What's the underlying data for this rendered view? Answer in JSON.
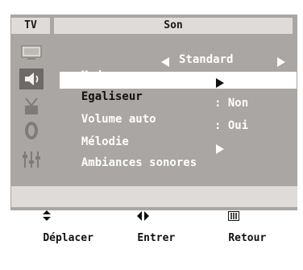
{
  "header": {
    "tv_label": "TV",
    "title": "Son"
  },
  "menu": {
    "items": [
      {
        "label": "Mode",
        "value": "Standard"
      },
      {
        "label": "Egaliseur"
      },
      {
        "label": "Volume auto",
        "value": ": Non"
      },
      {
        "label": "Mélodie",
        "value": ": Oui"
      },
      {
        "label": "Ambiances sonores"
      }
    ]
  },
  "footer": {
    "move_label": "Déplacer",
    "enter_label": "Entrer",
    "return_label": "Retour"
  },
  "icons": [
    "picture-icon",
    "sound-icon",
    "channel-icon",
    "setup-icon",
    "input-icon"
  ],
  "colors": {
    "panel": "#a9a6a3",
    "header": "#dedbd8",
    "highlight": "#ffffff",
    "text": "#ffffff"
  }
}
